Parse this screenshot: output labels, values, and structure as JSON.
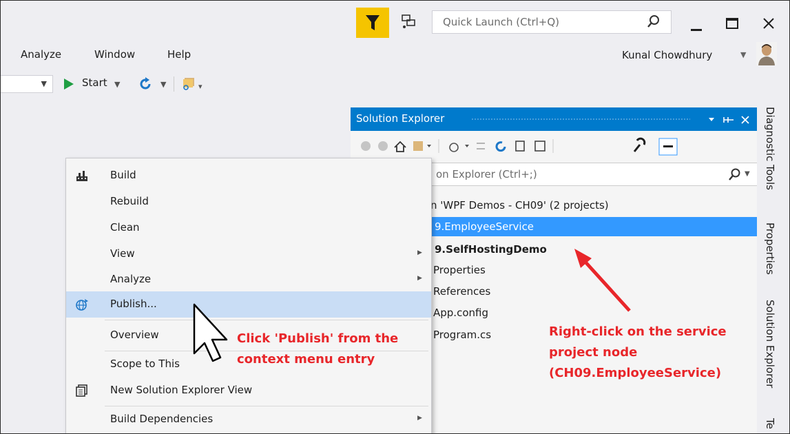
{
  "title_bar": {
    "quick_launch_placeholder": "Quick Launch (Ctrl+Q)",
    "filter_color": "#f5c400"
  },
  "menu": {
    "items": [
      "Analyze",
      "Window",
      "Help"
    ],
    "user_name": "Kunal Chowdhury"
  },
  "toolbar": {
    "start_label": "Start"
  },
  "solution_explorer": {
    "title": "Solution Explorer",
    "search_placeholder": "on Explorer (Ctrl+;)",
    "tree": [
      {
        "label": "n 'WPF Demos - CH09' (2 projects)",
        "selected": false,
        "bold": false
      },
      {
        "label": "9.EmployeeService",
        "selected": true,
        "bold": false
      },
      {
        "label": "9.SelfHostingDemo",
        "selected": false,
        "bold": true
      },
      {
        "label": "Properties",
        "selected": false,
        "bold": false
      },
      {
        "label": "References",
        "selected": false,
        "bold": false
      },
      {
        "label": "App.config",
        "selected": false,
        "bold": false
      },
      {
        "label": "Program.cs",
        "selected": false,
        "bold": false
      }
    ],
    "accent_color": "#007acc",
    "selection_color": "#3399ff"
  },
  "side_tabs": [
    "Diagnostic Tools",
    "Properties",
    "Solution Explorer",
    "Te"
  ],
  "context_menu": {
    "items": [
      {
        "label": "Build",
        "icon": "build-icon",
        "submenu": false
      },
      {
        "label": "Rebuild",
        "icon": "",
        "submenu": false
      },
      {
        "label": "Clean",
        "icon": "",
        "submenu": false
      },
      {
        "label": "View",
        "icon": "",
        "submenu": true
      },
      {
        "label": "Analyze",
        "icon": "",
        "submenu": true
      },
      {
        "label": "Publish...",
        "icon": "globe-publish-icon",
        "submenu": false,
        "highlighted": true
      },
      {
        "label": "Overview",
        "icon": "",
        "submenu": false
      },
      {
        "label": "Scope to This",
        "icon": "",
        "submenu": false
      },
      {
        "label": "New Solution Explorer View",
        "icon": "new-view-icon",
        "submenu": false
      },
      {
        "label": "Build Dependencies",
        "icon": "",
        "submenu": true
      }
    ]
  },
  "annotations": {
    "publish_note_line1": "Click 'Publish' from the",
    "publish_note_line2": "context menu entry",
    "service_note_line1": "Right-click on the service",
    "service_note_line2": "project node",
    "service_note_line3": "(CH09.EmployeeService)",
    "color": "#e8262a"
  }
}
